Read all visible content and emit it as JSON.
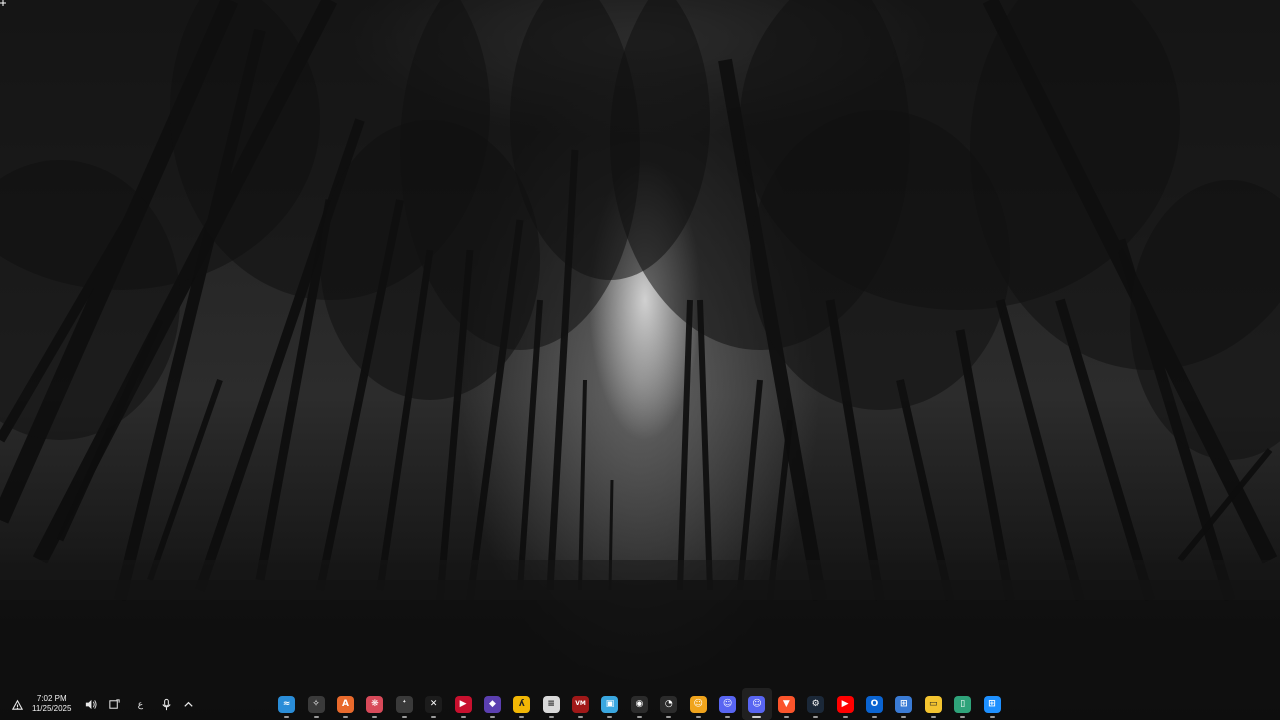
{
  "desktop": {
    "wallpaper": "black and white forest"
  },
  "taskbar": {
    "clock": {
      "time": "7:02 PM",
      "date": "11/25/2025"
    },
    "tray": {
      "language": "ع",
      "icons": [
        "network-icon",
        "volume-icon",
        "windows-update-icon",
        "microphone-icon",
        "chevron-up-icon"
      ]
    },
    "apps": [
      {
        "name": "widgets",
        "glyph": "≈",
        "bg": "#2a8dd8"
      },
      {
        "name": "seal",
        "glyph": "✧",
        "bg": "#3a3a3a"
      },
      {
        "name": "affinity",
        "glyph": "A",
        "bg": "#e96a2c"
      },
      {
        "name": "gift",
        "glyph": "❋",
        "bg": "#d84a5a"
      },
      {
        "name": "feather",
        "glyph": "ᐩ",
        "bg": "#3a3a3a"
      },
      {
        "name": "capcut",
        "glyph": "✕",
        "bg": "#1c1c1c"
      },
      {
        "name": "player",
        "glyph": "▶",
        "bg": "#c8102e"
      },
      {
        "name": "diamond",
        "glyph": "◆",
        "bg": "#5b3fb0"
      },
      {
        "name": "arc",
        "glyph": "ʎ",
        "bg": "#f2b705"
      },
      {
        "name": "notepad",
        "glyph": "≡",
        "bg": "#d9d9d9"
      },
      {
        "name": "voicemeeter",
        "glyph": "VM",
        "bg": "#a01818"
      },
      {
        "name": "photos",
        "glyph": "▣",
        "bg": "#3aa7e0"
      },
      {
        "name": "obs",
        "glyph": "◉",
        "bg": "#2b2b2b"
      },
      {
        "name": "speed",
        "glyph": "◔",
        "bg": "#2b2b2b"
      },
      {
        "name": "discord-canary",
        "glyph": "☺",
        "bg": "#f0a41c"
      },
      {
        "name": "discord-ptb",
        "glyph": "☺",
        "bg": "#5865f2"
      },
      {
        "name": "discord",
        "glyph": "☺",
        "bg": "#5865f2",
        "active": true
      },
      {
        "name": "brave",
        "glyph": "▼",
        "bg": "#fb542b"
      },
      {
        "name": "steam",
        "glyph": "⚙",
        "bg": "#1b2838"
      },
      {
        "name": "youtube",
        "glyph": "▶",
        "bg": "#ff0000"
      },
      {
        "name": "outlook",
        "glyph": "O",
        "bg": "#0a64d2"
      },
      {
        "name": "store",
        "glyph": "⊞",
        "bg": "#3a7bd5"
      },
      {
        "name": "file-explorer",
        "glyph": "▭",
        "bg": "#f4c430"
      },
      {
        "name": "files",
        "glyph": "▯",
        "bg": "#2fa37a"
      },
      {
        "name": "start",
        "glyph": "⊞",
        "bg": "#1e90ff"
      }
    ]
  }
}
